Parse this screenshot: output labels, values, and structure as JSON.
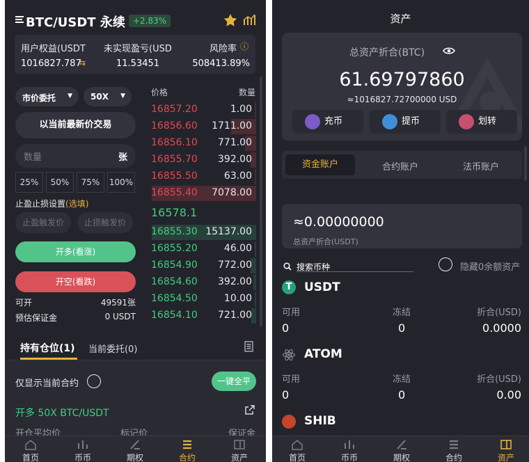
{
  "left": {
    "header": {
      "title": "BTC/USDT 永续",
      "change": "+2.83%"
    },
    "summary": {
      "equity_label": "用户权益(USDT",
      "equity_value": "1016827.787",
      "pnl_label": "未实现盈亏(USD",
      "pnl_value": "11.53451",
      "risk_label": "风险率",
      "risk_value": "508413.89%"
    },
    "order_type": "市价委托",
    "leverage": "50X",
    "latest_price_button": "以当前最新价交易",
    "quantity_placeholder": "数量",
    "quantity_unit": "张",
    "percents": [
      "25%",
      "50%",
      "75%",
      "100%"
    ],
    "tpsl_label": "止盈止损设置",
    "tpsl_optional": "(选填)",
    "tp_placeholder": "止盈触发价",
    "sl_placeholder": "止损触发价",
    "long_button": "开多(看涨)",
    "short_button": "开空(看跌)",
    "available_label": "可开",
    "available_value": "49591张",
    "margin_label": "预估保证金",
    "margin_value": "0 USDT",
    "orderbook": {
      "price_header": "价格",
      "qty_header": "数量",
      "asks": [
        {
          "price": "16857.20",
          "qty": "1.00"
        },
        {
          "price": "16856.60",
          "qty": "1711.00"
        },
        {
          "price": "16856.10",
          "qty": "771.00"
        },
        {
          "price": "16855.70",
          "qty": "392.00"
        },
        {
          "price": "16855.50",
          "qty": "63.00"
        },
        {
          "price": "16855.40",
          "qty": "7078.00"
        }
      ],
      "last_price": "16578.1",
      "bids": [
        {
          "price": "16855.30",
          "qty": "15137.00"
        },
        {
          "price": "16855.20",
          "qty": "46.00"
        },
        {
          "price": "16854.90",
          "qty": "772.00"
        },
        {
          "price": "16854.60",
          "qty": "392.00"
        },
        {
          "price": "16854.50",
          "qty": "10.00"
        },
        {
          "price": "16854.10",
          "qty": "721.00"
        }
      ]
    },
    "tabs": {
      "positions": "持有仓位(1)",
      "open_orders": "当前委托(0)"
    },
    "only_current_label": "仅显示当前合约",
    "close_all_button": "一键全平",
    "position": {
      "title": "开多 50X BTC/USDT",
      "col1": "开仓平均价",
      "col2": "标记价",
      "col3": "保证金"
    }
  },
  "right": {
    "title": "资产",
    "total_label": "总资产折合(BTC)",
    "total_btc": "61.69797860",
    "total_usd": "≈1016827.72700000 USD",
    "buttons": {
      "deposit": "充币",
      "withdraw": "提币",
      "transfer": "划转"
    },
    "account_tabs": [
      "资金账户",
      "合约账户",
      "法币账户"
    ],
    "balance_value": "≈0.00000000",
    "balance_label": "总资产折合(USDT)",
    "search_placeholder": "搜索币种",
    "hide_zero_label": "隐藏0余额资产",
    "coins": [
      {
        "symbol": "USDT",
        "available_label": "可用",
        "frozen_label": "冻结",
        "worth_label": "折合(USD)",
        "available": "0",
        "frozen": "0",
        "worth": "0.0000"
      },
      {
        "symbol": "ATOM",
        "available_label": "可用",
        "frozen_label": "冻结",
        "worth_label": "折合(USD)",
        "available": "0",
        "frozen": "0",
        "worth": "0.00"
      },
      {
        "symbol": "SHIB"
      }
    ]
  },
  "nav": [
    "首页",
    "币币",
    "期权",
    "合约",
    "资产"
  ],
  "colors": {
    "up": "#3fcf7e",
    "down": "#e04b52",
    "accent": "#e5b33c",
    "bg": "#23232b"
  }
}
